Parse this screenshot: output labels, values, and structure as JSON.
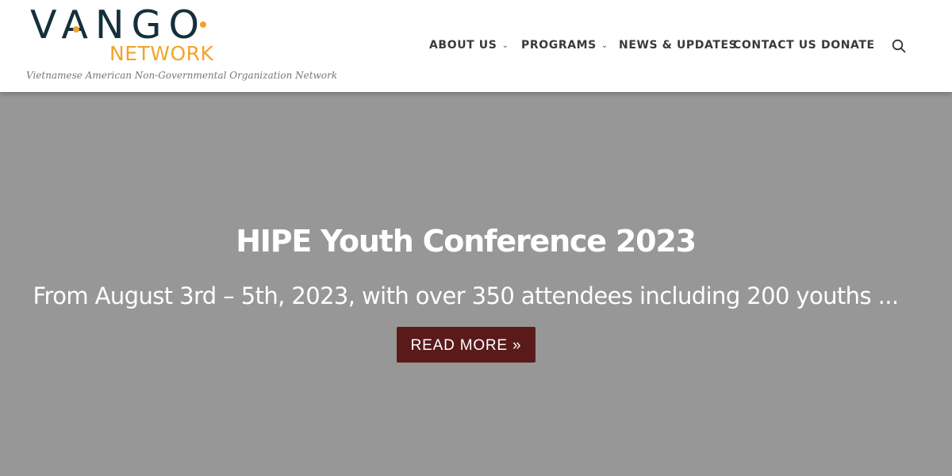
{
  "header": {
    "logo": {
      "main": "VANGO",
      "sub": "NETWORK",
      "tagline": "Vietnamese American Non-Governmental Organization Network"
    },
    "nav": [
      {
        "label": "ABOUT US",
        "has_dropdown": true
      },
      {
        "label": "PROGRAMS",
        "has_dropdown": true
      },
      {
        "label": "NEWS & UPDATES",
        "has_dropdown": false
      },
      {
        "label": "CONTACT US",
        "has_dropdown": false
      },
      {
        "label": "DONATE",
        "has_dropdown": false
      }
    ],
    "search_icon": "search-icon"
  },
  "hero": {
    "title": "HIPE Youth Conference 2023",
    "subtitle": "From August 3rd – 5th, 2023, with over 350 attendees including 200 youths ...",
    "button_label": "READ MORE »"
  },
  "colors": {
    "logo_dark": "#15303b",
    "logo_orange": "#f3a32a",
    "hero_background": "#979797",
    "button_background": "#5b1a1a",
    "nav_text": "#3a3a3a"
  }
}
